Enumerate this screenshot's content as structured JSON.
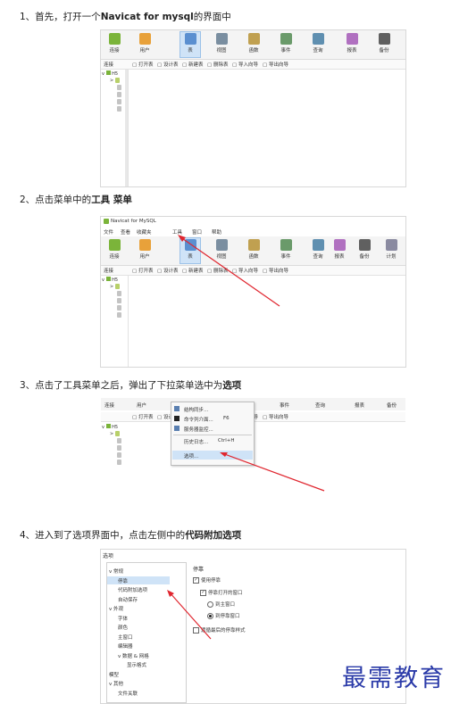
{
  "steps": [
    {
      "prefix": "1、首先，打开一个",
      "bold": "Navicat for mysql",
      "suffix": "的界面中"
    },
    {
      "prefix": "2、点击菜单中的",
      "bold": "工具 菜单",
      "suffix": ""
    },
    {
      "prefix": "3、点击了工具菜单之后，弹出了下拉菜单选中为",
      "bold": "选项",
      "suffix": ""
    },
    {
      "prefix": "4、进入到了选项界面中，点击左侧中的",
      "bold": "代码附加选项",
      "suffix": ""
    }
  ],
  "toolbar1": [
    "连接",
    "用户",
    "表",
    "视图",
    "函数",
    "事件",
    "查询",
    "报表",
    "备份"
  ],
  "toolbar2": [
    "连接",
    "用户",
    "表",
    "视图",
    "函数",
    "事件",
    "查询",
    "报表",
    "备份",
    "计划"
  ],
  "subbar": {
    "label": "连接",
    "items": [
      "打开表",
      "设计表",
      "新建表",
      "删除表",
      "导入向导",
      "导出向导"
    ]
  },
  "tree_root": "H5",
  "app_title": "Navicat for MySQL",
  "menubar": [
    "文件",
    "查看",
    "收藏夹",
    "工具",
    "窗口",
    "帮助"
  ],
  "shot3_top": [
    "连接",
    "用户",
    "事件",
    "查询",
    "报表",
    "备份"
  ],
  "dropdown": [
    {
      "label": "结构同步...",
      "key": ""
    },
    {
      "label": "命令列介面...",
      "key": "F6"
    },
    {
      "label": "服务器监控...",
      "key": ""
    },
    {
      "label": "历史日志...",
      "key": "Ctrl+H"
    },
    {
      "label": "选项...",
      "key": ""
    }
  ],
  "options_dialog": {
    "title": "选项",
    "left": [
      {
        "label": "常规",
        "level": 0,
        "expand": "v"
      },
      {
        "label": "停靠",
        "level": 1,
        "selected": true
      },
      {
        "label": "代码附加选项",
        "level": 1
      },
      {
        "label": "自动保存",
        "level": 1
      },
      {
        "label": "外观",
        "level": 0,
        "expand": "v"
      },
      {
        "label": "字体",
        "level": 1
      },
      {
        "label": "颜色",
        "level": 1
      },
      {
        "label": "主窗口",
        "level": 1
      },
      {
        "label": "编辑器",
        "level": 1
      },
      {
        "label": "数据 & 网格",
        "level": 1,
        "expand": "v"
      },
      {
        "label": "显示格式",
        "level": 2
      },
      {
        "label": "模型",
        "level": 0
      },
      {
        "label": "其他",
        "level": 0,
        "expand": "v"
      },
      {
        "label": "文件关联",
        "level": 1
      }
    ],
    "section": "停靠",
    "options": [
      {
        "type": "checkbox",
        "checked": true,
        "label": "使用停靠",
        "indent": 0
      },
      {
        "type": "checkbox",
        "checked": true,
        "label": "停靠打开的窗口",
        "indent": 1
      },
      {
        "type": "radio",
        "checked": false,
        "label": "到主窗口",
        "indent": 2
      },
      {
        "type": "radio",
        "checked": true,
        "label": "到停靠窗口",
        "indent": 2
      },
      {
        "type": "checkbox",
        "checked": false,
        "label": "遗循最后的停靠样式",
        "indent": 0
      }
    ]
  },
  "watermark": "最需教育",
  "colors": {
    "arrow": "#e0262f",
    "selected": "#cfe3f7",
    "watermark": "#2a3aa8"
  }
}
